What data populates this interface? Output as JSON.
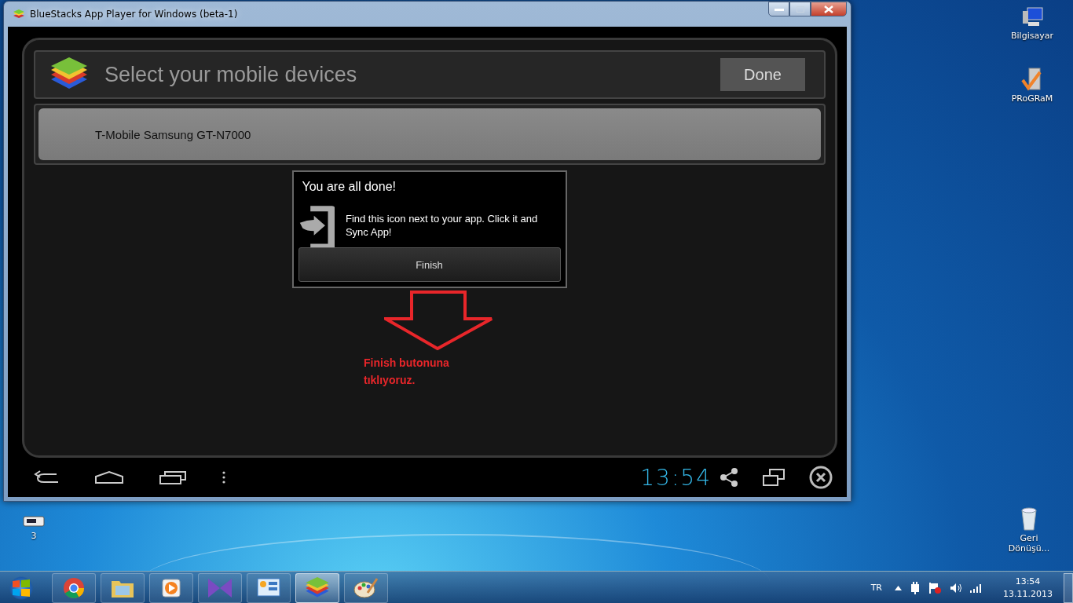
{
  "window": {
    "title": "BlueStacks App Player for Windows (beta-1)"
  },
  "app_header": {
    "title": "Select your mobile devices",
    "done_button": "Done"
  },
  "devices": [
    {
      "name": "T-Mobile Samsung GT-N7000"
    }
  ],
  "dialog": {
    "title": "You are all done!",
    "message": "Find this icon next to your app. Click it and Sync App!",
    "button": "Finish"
  },
  "annotation": {
    "text": "Finish butonuna tıklıyoruz."
  },
  "nav_bar": {
    "clock": "13:54"
  },
  "desktop_icons": [
    {
      "label": "Bilgisayar",
      "kind": "computer"
    },
    {
      "label": "PRoGRaM",
      "kind": "program"
    },
    {
      "label": "3",
      "kind": "drive"
    },
    {
      "label": "Geri Dönüşü...",
      "kind": "trash"
    }
  ],
  "taskbar": {
    "items": [
      {
        "kind": "chrome",
        "selected": false
      },
      {
        "kind": "folder",
        "selected": false
      },
      {
        "kind": "media",
        "selected": false
      },
      {
        "kind": "bowtie",
        "selected": false
      },
      {
        "kind": "panel",
        "selected": false
      },
      {
        "kind": "stack",
        "selected": true
      },
      {
        "kind": "palette",
        "selected": false
      }
    ],
    "language": "TR",
    "time": "13:54",
    "date": "13.11.2013"
  }
}
